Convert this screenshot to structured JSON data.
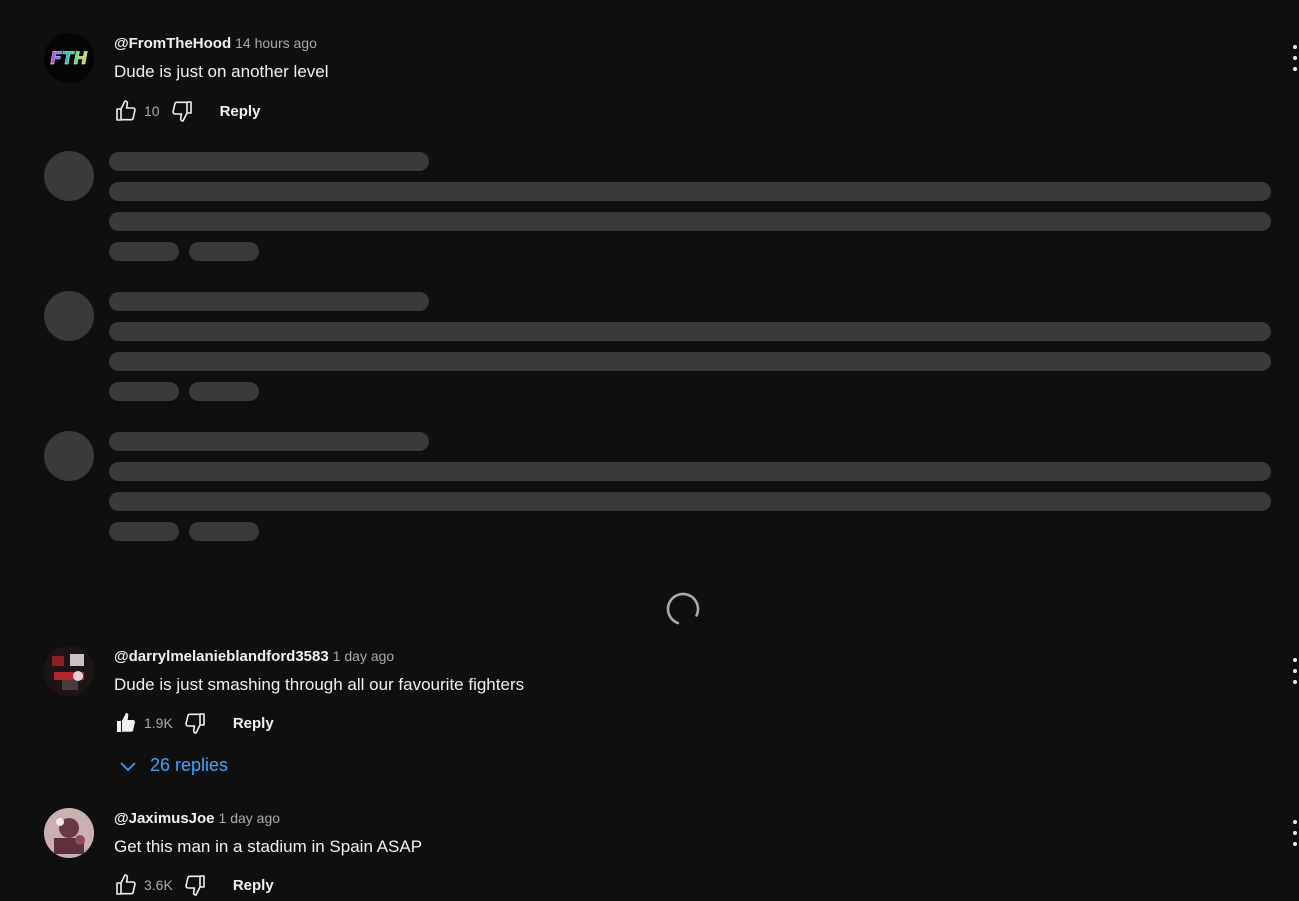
{
  "comments": [
    {
      "author": "@FromTheHood",
      "time": "14 hours ago",
      "text": "Dude is just on another level",
      "likes": "10",
      "reply_label": "Reply",
      "liked": false
    },
    {
      "author": "@darrylmelanieblandford3583",
      "time": "1 day ago",
      "text": "Dude is just smashing through all our favourite fighters",
      "likes": "1.9K",
      "reply_label": "Reply",
      "liked": true,
      "replies_label": "26 replies"
    },
    {
      "author": "@JaximusJoe",
      "time": "1 day ago",
      "text": "Get this man in a stadium in Spain ASAP",
      "likes": "3.6K",
      "reply_label": "Reply",
      "liked": false
    }
  ],
  "avatar_logos": {
    "fromthehood": "FTH"
  },
  "colors": {
    "background": "#0f0f0f",
    "link": "#3ea6ff",
    "skeleton": "#3a3a3a",
    "muted": "#aaaaaa"
  },
  "icons": [
    "thumbs-up-icon",
    "thumbs-down-icon",
    "kebab-menu-icon",
    "chevron-down-icon",
    "loading-spinner-icon"
  ]
}
